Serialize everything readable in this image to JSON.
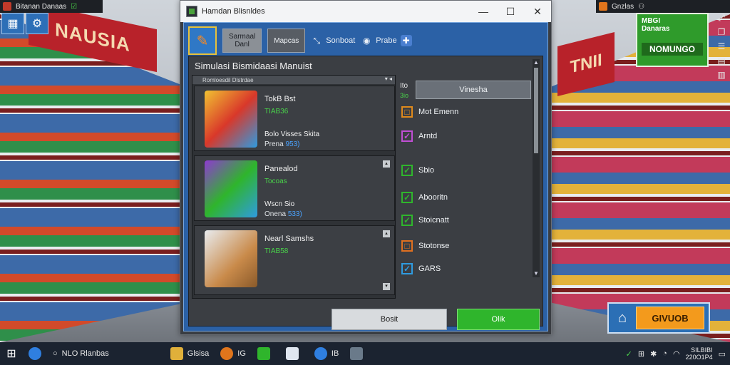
{
  "desktop": {
    "top_left": {
      "title": "Bitanan Danaas"
    },
    "top_right": {
      "label": "Gnzlas"
    },
    "logo": {
      "line1": "MBGI",
      "line2": "Danaras",
      "line3": "NOMUNGO"
    },
    "shop_button": {
      "label": "GIVUOB"
    },
    "banner_left": "NAUSIA",
    "banner_right": "TNII"
  },
  "window": {
    "title": "Hamdan Blisnldes",
    "controls": {
      "minimize": "—",
      "maximize": "☐",
      "close": "✕"
    },
    "tabs": [
      {
        "line1": "Sarmaal",
        "line2": "Danl",
        "active": true
      },
      {
        "line1": "Mapcas",
        "line2": "",
        "active": false
      }
    ],
    "links": [
      {
        "label": "Sonboat"
      },
      {
        "label": "Prabe"
      }
    ],
    "panel_title": "Simulasi Bismidaasi Manuist",
    "list_header": "Romloesdil Dlstrdae",
    "items": [
      {
        "name": "TokB Bst",
        "price": "TIAB36",
        "sub": "Bolo Visses Skita",
        "sub2_label": "Prena",
        "sub2_value": "953)"
      },
      {
        "name": "Panealod",
        "price": "Tocoas",
        "sub": "Wscn Sio",
        "sub2_label": "Onena",
        "sub2_value": "533)"
      },
      {
        "name": "Nearl Samshs",
        "price": "TIAB58",
        "sub": "",
        "sub2_label": "",
        "sub2_value": ""
      }
    ],
    "right_panel": {
      "head1": "Ito",
      "head2": "3io",
      "button": "Vinesha",
      "options": [
        {
          "label": "Mot Emenn",
          "checked": false,
          "color": "#e08a1c"
        },
        {
          "label": "Arntd",
          "checked": true,
          "color": "#c04fd4"
        },
        {
          "label": "Sbio",
          "checked": true,
          "color": "#2fb52c"
        },
        {
          "label": "Abooritn",
          "checked": true,
          "color": "#2fb52c"
        },
        {
          "label": "Stoicnatt",
          "checked": true,
          "color": "#2fb52c"
        },
        {
          "label": "Stotonse",
          "checked": false,
          "color": "#e07020"
        },
        {
          "label": "GARS",
          "checked": true,
          "color": "#2f9be0"
        }
      ]
    },
    "buttons": {
      "cancel": "Bosit",
      "ok": "Olik"
    }
  },
  "taskbar": {
    "search": "NLO Rlanbas",
    "apps": [
      {
        "label": "Glsisa"
      },
      {
        "label": "IG"
      },
      {
        "label": ""
      },
      {
        "label": ""
      },
      {
        "label": "IB"
      },
      {
        "label": ""
      }
    ],
    "tray": {
      "date_line1": "SILBIBI",
      "date_line2": "220O1P4"
    }
  }
}
